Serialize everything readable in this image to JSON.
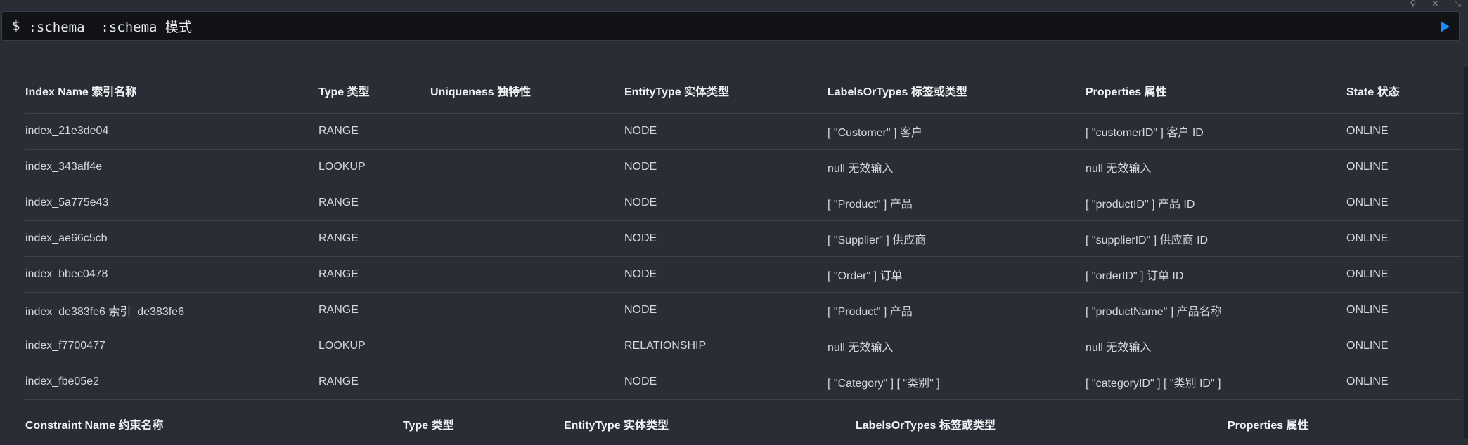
{
  "command": {
    "prompt": "$",
    "text": ":schema  :schema 模式"
  },
  "indexes": {
    "headers": {
      "name": "Index Name  索引名称",
      "type": "Type  类型",
      "uniqueness": "Uniqueness  独特性",
      "entity_type": "EntityType  实体类型",
      "labels": "LabelsOrTypes  标签或类型",
      "properties": "Properties  属性",
      "state": "State  状态"
    },
    "rows": [
      {
        "name": "index_21e3de04",
        "type": "RANGE",
        "uniqueness": "",
        "entity_type": "NODE",
        "labels": "[ \"Customer\" ]  客户",
        "properties": "[ \"customerID\" ]  客户 ID",
        "state": "ONLINE"
      },
      {
        "name": "index_343aff4e",
        "type": "LOOKUP",
        "uniqueness": "",
        "entity_type": "NODE",
        "labels": "null  无效输入",
        "properties": "null  无效输入",
        "state": "ONLINE"
      },
      {
        "name": "index_5a775e43",
        "type": "RANGE",
        "uniqueness": "",
        "entity_type": "NODE",
        "labels": "[ \"Product\" ]  产品",
        "properties": "[ \"productID\" ]  产品 ID",
        "state": "ONLINE"
      },
      {
        "name": "index_ae66c5cb",
        "type": "RANGE",
        "uniqueness": "",
        "entity_type": "NODE",
        "labels": "[ \"Supplier\" ]  供应商",
        "properties": "[ \"supplierID\" ]  供应商 ID",
        "state": "ONLINE"
      },
      {
        "name": "index_bbec0478",
        "type": "RANGE",
        "uniqueness": "",
        "entity_type": "NODE",
        "labels": "[ \"Order\" ]  订单",
        "properties": "[ \"orderID\" ]  订单 ID",
        "state": "ONLINE"
      },
      {
        "name": "index_de383fe6  索引_de383fe6",
        "type": "RANGE",
        "uniqueness": "",
        "entity_type": "NODE",
        "labels": "[ \"Product\" ]  产品",
        "properties": "[ \"productName\" ]  产品名称",
        "state": "ONLINE"
      },
      {
        "name": "index_f7700477",
        "type": "LOOKUP",
        "uniqueness": "",
        "entity_type": "RELATIONSHIP",
        "labels": "null  无效输入",
        "properties": "null  无效输入",
        "state": "ONLINE"
      },
      {
        "name": "index_fbe05e2",
        "type": "RANGE",
        "uniqueness": "",
        "entity_type": "NODE",
        "labels": "[ \"Category\" ]  [ \"类别\" ]",
        "properties": "[ \"categoryID\" ]  [ \"类别 ID\" ]",
        "state": "ONLINE"
      }
    ]
  },
  "constraints": {
    "headers": {
      "name": "Constraint Name  约束名称",
      "type": "Type  类型",
      "entity_type": "EntityType  实体类型",
      "labels": "LabelsOrTypes  标签或类型",
      "properties": "Properties  属性"
    }
  },
  "icons": {
    "run": "play-icon",
    "pin": "pin-icon",
    "close": "close-icon",
    "collapse": "collapse-icon"
  },
  "colors": {
    "background": "#2a2d36",
    "command_bar": "#111317",
    "accent": "#1a8cff"
  }
}
